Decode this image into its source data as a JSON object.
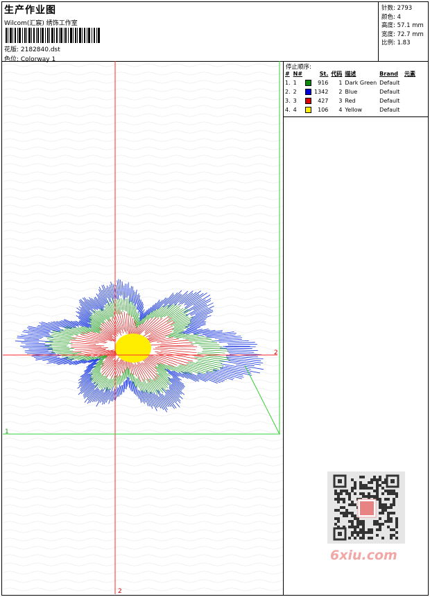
{
  "header": {
    "title": "生产作业图",
    "studio": "Wilcom(汇宸) 绣饰工作室",
    "design": "花版: 2182840.dst",
    "colorway": "色位: Colorway 1"
  },
  "stats": {
    "stitches": "针数: 2793",
    "colors": "颜色: 4",
    "height": "高度: 57.1 mm",
    "width": "宽度: 72.7 mm",
    "scale": "比例: 1.83"
  },
  "stop_sequence": {
    "title": "停止顺序:",
    "headers": [
      "#",
      "N#",
      "St.",
      "代码",
      "描述",
      "Brand",
      "元素"
    ],
    "rows": [
      {
        "idx": "1.",
        "n": "1",
        "color": "#0a8a0a",
        "st": "916",
        "code": "1",
        "desc": "Dark Green",
        "brand": "Default"
      },
      {
        "idx": "2.",
        "n": "2",
        "color": "#0000dd",
        "st": "1342",
        "code": "2",
        "desc": "Blue",
        "brand": "Default"
      },
      {
        "idx": "3.",
        "n": "3",
        "color": "#dd0000",
        "st": "427",
        "code": "3",
        "desc": "Red",
        "brand": "Default"
      },
      {
        "idx": "4.",
        "n": "4",
        "color": "#ffee00",
        "st": "106",
        "code": "4",
        "desc": "Yellow",
        "brand": "Default"
      }
    ]
  },
  "guides": {
    "red_top": "2",
    "red_bottom": "2",
    "green_left": "1"
  },
  "watermark": "6xiu.com",
  "colors": {
    "guide_red": "#ff2a2a",
    "guide_green": "#35d035",
    "stitch_blue": "#1030e0",
    "stitch_green": "#1a9a1a",
    "stitch_red": "#dd1010",
    "stitch_yellow": "#ffee00"
  }
}
